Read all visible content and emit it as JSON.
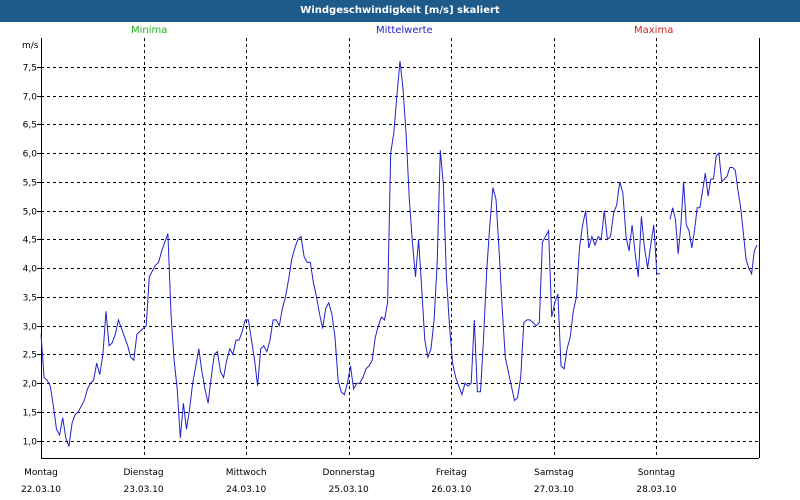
{
  "title": "Windgeschwindigkeit [m/s] skaliert",
  "legend": {
    "minima": {
      "label": "Minima",
      "color": "#22b022"
    },
    "mittel": {
      "label": "Mittelwerte",
      "color": "#2222cc"
    },
    "maxima": {
      "label": "Maxima",
      "color": "#cc2222"
    }
  },
  "chart_data": {
    "type": "line",
    "title": "Windgeschwindigkeit [m/s] skaliert",
    "ylabel": "m/s",
    "xlabel": "",
    "ylim": [
      0.7,
      8.0
    ],
    "yticks": [
      "1,0",
      "1,5",
      "2,0",
      "2,5",
      "3,0",
      "3,5",
      "4,0",
      "4,5",
      "5,0",
      "5,5",
      "6,0",
      "6,5",
      "7,0",
      "7,5"
    ],
    "ytick_values": [
      1.0,
      1.5,
      2.0,
      2.5,
      3.0,
      3.5,
      4.0,
      4.5,
      5.0,
      5.5,
      6.0,
      6.5,
      7.0,
      7.5
    ],
    "days": [
      {
        "name": "Montag",
        "date": "22.03.10"
      },
      {
        "name": "Dienstag",
        "date": "23.03.10"
      },
      {
        "name": "Mittwoch",
        "date": "24.03.10"
      },
      {
        "name": "Donnerstag",
        "date": "25.03.10"
      },
      {
        "name": "Freitag",
        "date": "26.03.10"
      },
      {
        "name": "Samstag",
        "date": "27.03.10"
      },
      {
        "name": "Sonntag",
        "date": "28.03.10"
      }
    ],
    "grid": true,
    "series": [
      {
        "name": "Mittelwerte",
        "color": "#2222cc",
        "segments": [
          [
            2.85,
            2.1,
            2.05,
            1.95,
            1.6,
            1.2,
            1.1,
            1.4,
            1.05,
            0.9,
            1.3,
            1.45,
            1.5,
            1.6,
            1.7,
            1.9,
            2.0,
            2.05,
            2.35,
            2.15,
            2.5,
            3.25,
            2.65,
            2.7,
            2.85,
            3.1,
            2.95,
            2.8,
            2.65,
            2.45,
            2.4,
            2.85,
            2.9,
            2.95,
            3.0,
            3.85,
            3.95,
            4.05,
            4.1,
            4.3,
            4.45,
            4.6,
            3.2,
            2.4,
            1.9,
            1.05,
            1.65,
            1.2,
            1.55,
            2.0,
            2.3,
            2.6,
            2.2,
            1.9,
            1.65,
            2.1,
            2.5,
            2.55,
            2.2,
            2.1,
            2.4,
            2.6,
            2.5,
            2.75,
            2.75,
            2.9,
            3.1,
            3.1,
            2.75,
            2.4,
            1.95,
            2.6,
            2.65,
            2.55,
            2.75,
            3.1,
            3.1,
            3.0,
            3.3,
            3.5,
            3.8,
            4.15,
            4.35,
            4.5,
            4.55,
            4.2,
            4.1,
            4.1,
            3.75,
            3.5,
            3.2,
            2.95,
            3.3,
            3.4,
            3.2,
            2.8,
            2.05,
            1.85,
            1.8,
            2.0,
            2.3,
            1.9,
            2.0,
            2.0,
            2.1,
            2.25,
            2.3,
            2.4,
            2.8,
            3.0,
            3.15,
            3.1,
            3.4,
            6.0,
            6.35,
            7.0,
            7.6,
            7.1,
            6.3,
            5.2,
            4.45,
            3.85,
            4.5,
            3.65,
            2.75,
            2.45,
            2.6,
            3.1,
            4.1,
            6.05,
            5.45,
            3.85,
            3.0,
            2.35,
            2.1,
            1.95,
            1.8,
            2.0,
            1.95,
            2.0,
            3.1,
            1.85,
            1.85,
            2.8,
            3.95,
            4.75,
            5.4,
            5.2,
            4.3,
            3.3,
            2.45,
            2.2,
            1.95,
            1.7,
            1.75,
            2.1,
            3.05,
            3.1,
            3.1,
            3.05,
            3.0,
            3.05,
            4.45,
            4.55,
            4.65,
            3.15,
            3.4,
            3.55,
            2.3,
            2.25,
            2.6,
            2.8,
            3.25,
            3.5,
            4.35,
            4.75,
            5.0,
            4.35,
            4.55,
            4.4,
            4.55,
            4.5,
            5.0,
            4.5,
            4.55,
            4.95,
            5.1,
            5.5,
            5.3,
            4.55,
            4.3,
            4.75,
            4.25,
            3.85,
            4.9,
            4.35,
            4.0,
            4.4,
            4.75,
            3.9,
            3.9
          ],
          [
            4.85,
            5.05,
            4.85,
            4.25,
            4.75,
            5.5,
            4.75,
            4.65,
            4.35,
            4.65,
            5.05,
            5.05,
            5.35,
            5.65,
            5.25,
            5.55,
            5.55,
            5.95,
            6.0,
            5.5,
            5.55,
            5.6,
            5.75,
            5.75,
            5.7,
            5.35,
            5.05,
            4.6,
            4.15,
            4.0,
            3.9,
            4.3,
            4.4
          ]
        ]
      }
    ]
  }
}
